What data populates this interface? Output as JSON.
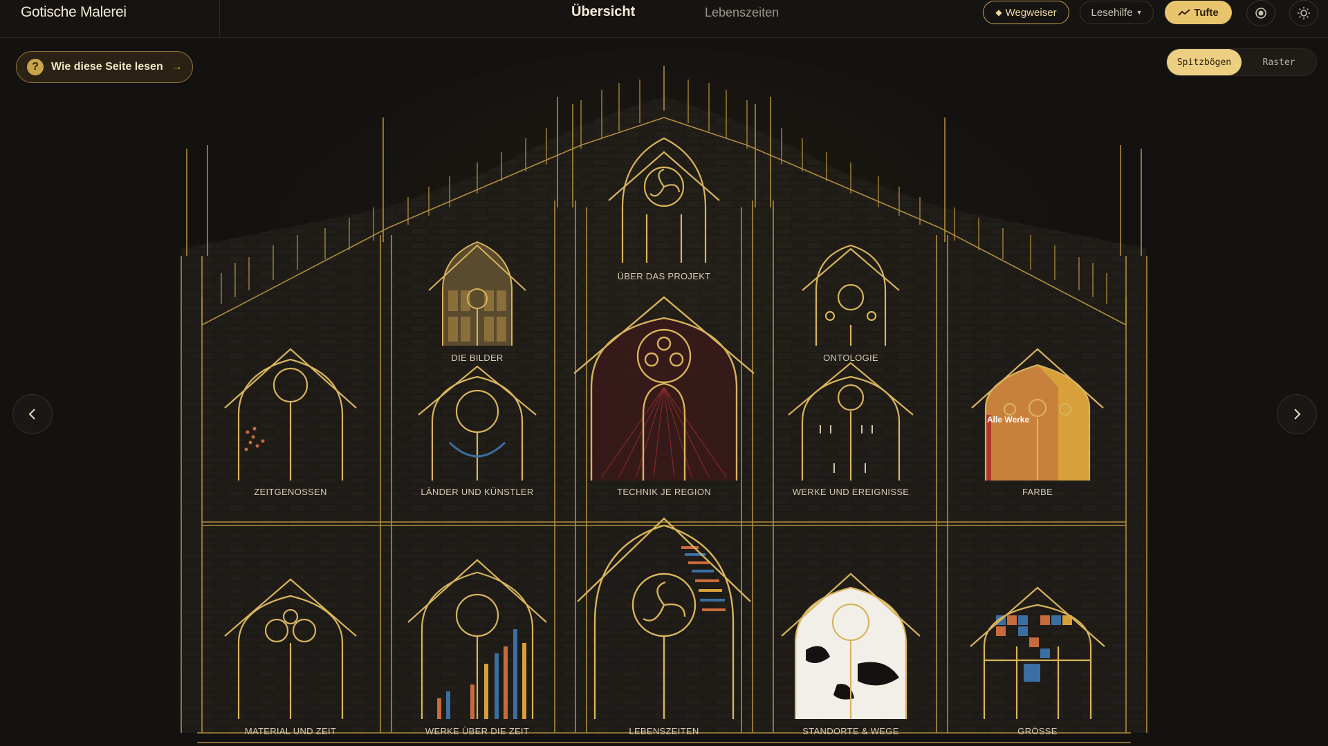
{
  "header": {
    "brand": "Gotische Malerei",
    "tabs": [
      {
        "label": "Übersicht",
        "active": true
      },
      {
        "label": "Lebenszeiten",
        "active": false
      }
    ],
    "wegweiser_label": "Wegweiser",
    "lesehilfe_label": "Lesehilfe",
    "tufte_label": "Tufte"
  },
  "howto": {
    "label": "Wie diese Seite lesen",
    "arrow": "→",
    "icon_char": "?"
  },
  "view_toggle": {
    "options": [
      "Spitzbögen",
      "Raster"
    ],
    "selected": "Spitzbögen"
  },
  "windows": [
    {
      "id": "ueber",
      "label": "ÜBER DAS PROJEKT"
    },
    {
      "id": "bilder",
      "label": "DIE BILDER"
    },
    {
      "id": "ontologie",
      "label": "ONTOLOGIE"
    },
    {
      "id": "zeitgenossen",
      "label": "ZEITGENOSSEN"
    },
    {
      "id": "laender",
      "label": "LÄNDER UND KÜNSTLER"
    },
    {
      "id": "technik",
      "label": "TECHNIK JE REGION"
    },
    {
      "id": "werke_ereignisse",
      "label": "WERKE UND EREIGNISSE"
    },
    {
      "id": "farbe",
      "label": "FARBE",
      "inner_label": "Alle Werke"
    },
    {
      "id": "material",
      "label": "MATERIAL UND ZEIT"
    },
    {
      "id": "werke_zeit",
      "label": "WERKE ÜBER DIE ZEIT"
    },
    {
      "id": "lebenszeiten",
      "label": "LEBENSZEITEN"
    },
    {
      "id": "standorte",
      "label": "STANDORTE & WEGE"
    },
    {
      "id": "groesse",
      "label": "GRÖSSE"
    }
  ],
  "colors": {
    "gold": "#c9a44a",
    "gold_light": "#e8c46d",
    "background": "#141210",
    "stone": "#1d1a16"
  }
}
